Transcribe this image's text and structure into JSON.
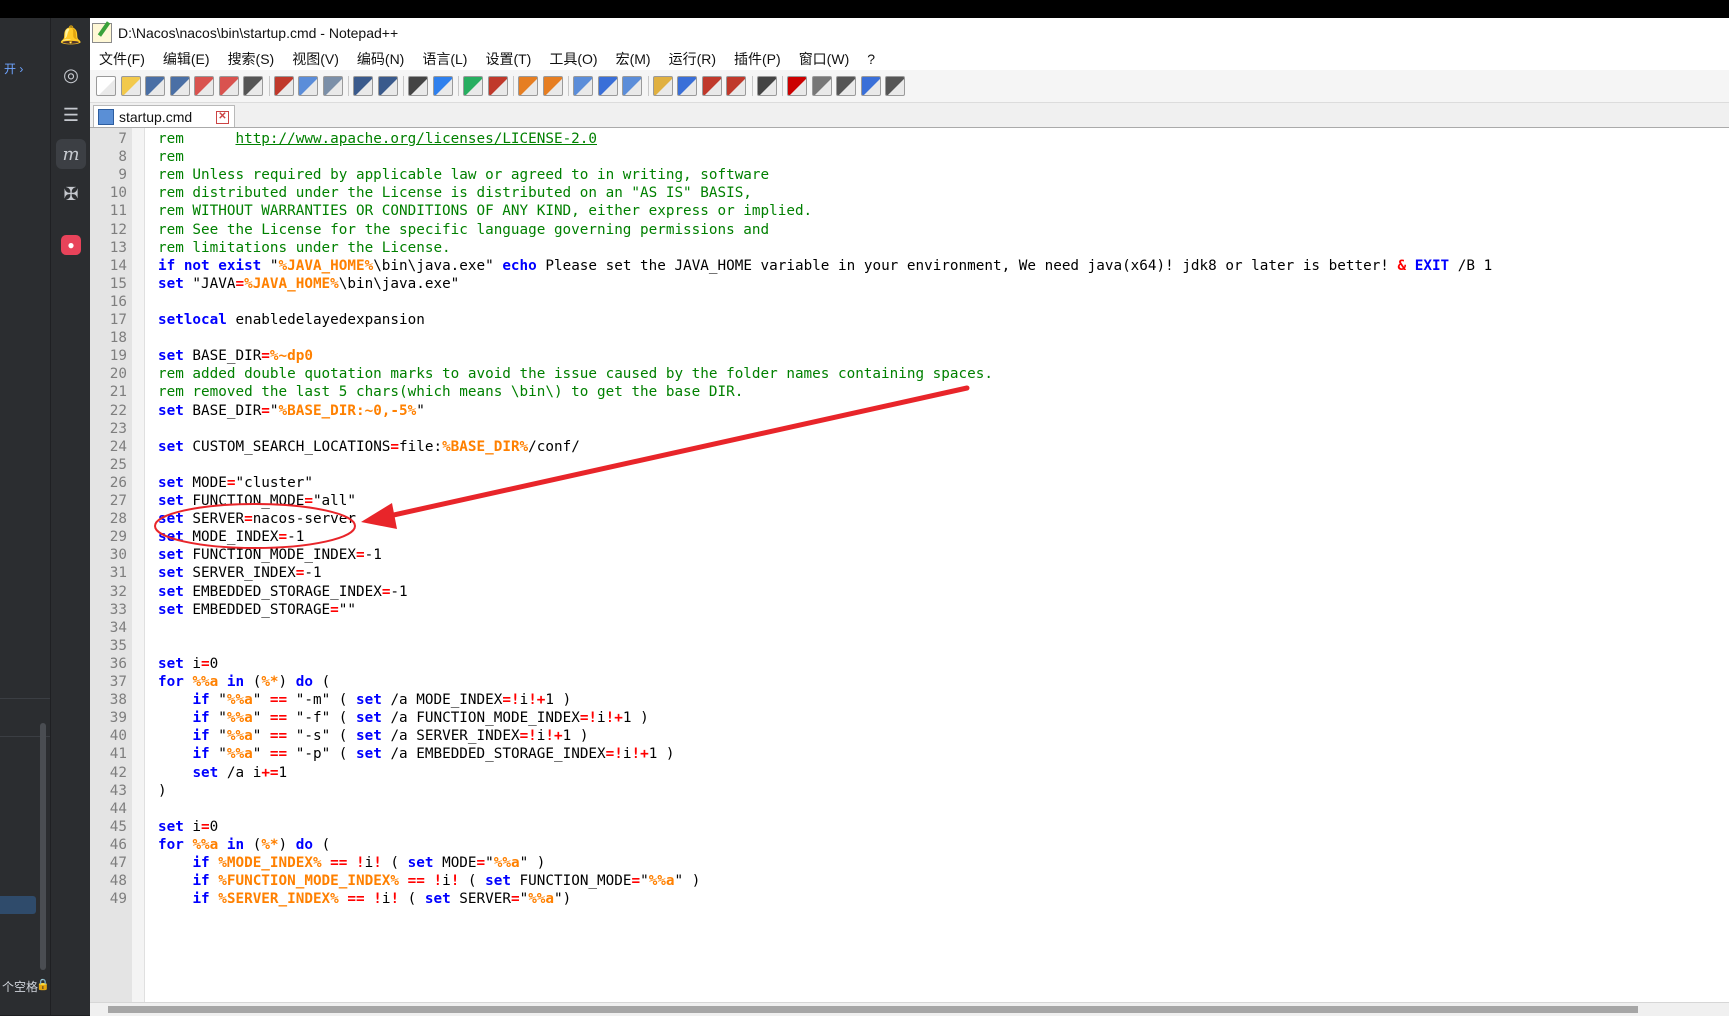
{
  "window": {
    "title": "D:\\Nacos\\nacos\\bin\\startup.cmd - Notepad++"
  },
  "menu": [
    "文件(F)",
    "编辑(E)",
    "搜索(S)",
    "视图(V)",
    "编码(N)",
    "语言(L)",
    "设置(T)",
    "工具(O)",
    "宏(M)",
    "运行(R)",
    "插件(P)",
    "窗口(W)",
    "?"
  ],
  "tab": {
    "label": "startup.cmd",
    "close": "✕"
  },
  "left_sidebar": {
    "nav_text": "开 ›",
    "status_text": "个空格",
    "lock_glyph": "🔒"
  },
  "left_strip_icons": [
    {
      "name": "bell-icon",
      "glyph": "🔔"
    },
    {
      "name": "spiral-icon",
      "glyph": "◎"
    },
    {
      "name": "database-icon",
      "glyph": "☰"
    },
    {
      "name": "m-icon",
      "glyph": "m"
    },
    {
      "name": "tools-icon",
      "glyph": "✠"
    },
    {
      "name": "red-app-icon",
      "glyph": "●"
    }
  ],
  "toolbar_icons": [
    "new-file-icon",
    "open-file-icon",
    "save-icon",
    "save-all-icon",
    "close-icon",
    "close-all-icon",
    "print-icon",
    "cut-icon",
    "copy-icon",
    "paste-icon",
    "undo-icon",
    "redo-icon",
    "find-icon",
    "replace-icon",
    "zoom-in-icon",
    "zoom-out-icon",
    "sync-v-icon",
    "sync-h-icon",
    "word-wrap-icon",
    "show-all-chars-icon",
    "indent-guide-icon",
    "doc-map-icon",
    "function-list-icon",
    "folder-workspace-icon",
    "monitor-icon",
    "eye-icon",
    "record-macro-icon",
    "stop-macro-icon",
    "play-macro-icon",
    "run-macro-multiple-icon",
    "save-macro-icon"
  ],
  "code_lines": [
    {
      "n": "7",
      "t": [
        [
          "rem",
          "rem"
        ],
        [
          "rem",
          "      "
        ],
        [
          "link",
          "http://www.apache.org/licenses/LICENSE-2.0"
        ]
      ]
    },
    {
      "n": "8",
      "t": [
        [
          "rem",
          "rem"
        ]
      ]
    },
    {
      "n": "9",
      "t": [
        [
          "rem",
          "rem Unless required by applicable law or agreed to in writing, software"
        ]
      ]
    },
    {
      "n": "10",
      "t": [
        [
          "rem",
          "rem distributed under the License is distributed on an \"AS IS\" BASIS,"
        ]
      ]
    },
    {
      "n": "11",
      "t": [
        [
          "rem",
          "rem WITHOUT WARRANTIES OR CONDITIONS OF ANY KIND, either express or implied."
        ]
      ]
    },
    {
      "n": "12",
      "t": [
        [
          "rem",
          "rem See the License for the specific language governing permissions and"
        ]
      ]
    },
    {
      "n": "13",
      "t": [
        [
          "rem",
          "rem limitations under the License."
        ]
      ]
    },
    {
      "n": "14",
      "t": [
        [
          "kw",
          "if not exist"
        ],
        [
          "plain",
          " \""
        ],
        [
          "var",
          "%JAVA_HOME%"
        ],
        [
          "plain",
          "\\bin\\java.exe\" "
        ],
        [
          "kw",
          "echo"
        ],
        [
          "plain",
          " Please set the JAVA_HOME variable in your environment, We need java(x64)! jdk8 or later is better! "
        ],
        [
          "op",
          "&"
        ],
        [
          "plain",
          " "
        ],
        [
          "kw",
          "EXIT"
        ],
        [
          "plain",
          " /B 1"
        ]
      ]
    },
    {
      "n": "15",
      "t": [
        [
          "kw",
          "set"
        ],
        [
          "plain",
          " \"JAVA"
        ],
        [
          "op",
          "="
        ],
        [
          "var",
          "%JAVA_HOME%"
        ],
        [
          "plain",
          "\\bin\\java.exe\""
        ]
      ]
    },
    {
      "n": "16",
      "t": []
    },
    {
      "n": "17",
      "t": [
        [
          "kw",
          "setlocal"
        ],
        [
          "plain",
          " enabledelayedexpansion"
        ]
      ]
    },
    {
      "n": "18",
      "t": []
    },
    {
      "n": "19",
      "t": [
        [
          "kw",
          "set"
        ],
        [
          "plain",
          " BASE_DIR"
        ],
        [
          "op",
          "="
        ],
        [
          "var",
          "%~dp0"
        ]
      ]
    },
    {
      "n": "20",
      "t": [
        [
          "rem",
          "rem added double quotation marks to avoid the issue caused by the folder names containing spaces."
        ]
      ]
    },
    {
      "n": "21",
      "t": [
        [
          "rem",
          "rem removed the last 5 chars(which means \\bin\\) to get the base DIR."
        ]
      ]
    },
    {
      "n": "22",
      "t": [
        [
          "kw",
          "set"
        ],
        [
          "plain",
          " BASE_DIR"
        ],
        [
          "op",
          "="
        ],
        [
          "plain",
          "\""
        ],
        [
          "var",
          "%BASE_DIR:~0,-5%"
        ],
        [
          "plain",
          "\""
        ]
      ]
    },
    {
      "n": "23",
      "t": []
    },
    {
      "n": "24",
      "t": [
        [
          "kw",
          "set"
        ],
        [
          "plain",
          " CUSTOM_SEARCH_LOCATIONS"
        ],
        [
          "op",
          "="
        ],
        [
          "plain",
          "file:"
        ],
        [
          "var",
          "%BASE_DIR%"
        ],
        [
          "plain",
          "/conf/"
        ]
      ]
    },
    {
      "n": "25",
      "t": []
    },
    {
      "n": "26",
      "t": [
        [
          "kw",
          "set"
        ],
        [
          "plain",
          " MODE"
        ],
        [
          "op",
          "="
        ],
        [
          "plain",
          "\"cluster\""
        ]
      ]
    },
    {
      "n": "27",
      "t": [
        [
          "kw",
          "set"
        ],
        [
          "plain",
          " FUNCTION_MODE"
        ],
        [
          "op",
          "="
        ],
        [
          "plain",
          "\"all\""
        ]
      ]
    },
    {
      "n": "28",
      "t": [
        [
          "kw",
          "set"
        ],
        [
          "plain",
          " SERVER"
        ],
        [
          "op",
          "="
        ],
        [
          "plain",
          "nacos-server"
        ]
      ]
    },
    {
      "n": "29",
      "t": [
        [
          "kw",
          "set"
        ],
        [
          "plain",
          " MODE_INDEX"
        ],
        [
          "op",
          "="
        ],
        [
          "plain",
          "-1"
        ]
      ]
    },
    {
      "n": "30",
      "t": [
        [
          "kw",
          "set"
        ],
        [
          "plain",
          " FUNCTION_MODE_INDEX"
        ],
        [
          "op",
          "="
        ],
        [
          "plain",
          "-1"
        ]
      ]
    },
    {
      "n": "31",
      "t": [
        [
          "kw",
          "set"
        ],
        [
          "plain",
          " SERVER_INDEX"
        ],
        [
          "op",
          "="
        ],
        [
          "plain",
          "-1"
        ]
      ]
    },
    {
      "n": "32",
      "t": [
        [
          "kw",
          "set"
        ],
        [
          "plain",
          " EMBEDDED_STORAGE_INDEX"
        ],
        [
          "op",
          "="
        ],
        [
          "plain",
          "-1"
        ]
      ]
    },
    {
      "n": "33",
      "t": [
        [
          "kw",
          "set"
        ],
        [
          "plain",
          " EMBEDDED_STORAGE"
        ],
        [
          "op",
          "="
        ],
        [
          "plain",
          "\"\""
        ]
      ]
    },
    {
      "n": "34",
      "t": []
    },
    {
      "n": "35",
      "t": []
    },
    {
      "n": "36",
      "t": [
        [
          "kw",
          "set"
        ],
        [
          "plain",
          " i"
        ],
        [
          "op",
          "="
        ],
        [
          "plain",
          "0"
        ]
      ]
    },
    {
      "n": "37",
      "t": [
        [
          "kw",
          "for"
        ],
        [
          "plain",
          " "
        ],
        [
          "var",
          "%%a"
        ],
        [
          "plain",
          " "
        ],
        [
          "kw",
          "in"
        ],
        [
          "plain",
          " ("
        ],
        [
          "var",
          "%*"
        ],
        [
          "plain",
          ") "
        ],
        [
          "kw",
          "do"
        ],
        [
          "plain",
          " ("
        ]
      ]
    },
    {
      "n": "38",
      "t": [
        [
          "plain",
          "    "
        ],
        [
          "kw",
          "if"
        ],
        [
          "plain",
          " \""
        ],
        [
          "var",
          "%%a"
        ],
        [
          "plain",
          "\" "
        ],
        [
          "op",
          "=="
        ],
        [
          "plain",
          " \"-m\" ( "
        ],
        [
          "kw",
          "set"
        ],
        [
          "plain",
          " /a MODE_INDEX"
        ],
        [
          "op",
          "=!"
        ],
        [
          "plain",
          "i"
        ],
        [
          "op",
          "!+"
        ],
        [
          "plain",
          "1 )"
        ]
      ]
    },
    {
      "n": "39",
      "t": [
        [
          "plain",
          "    "
        ],
        [
          "kw",
          "if"
        ],
        [
          "plain",
          " \""
        ],
        [
          "var",
          "%%a"
        ],
        [
          "plain",
          "\" "
        ],
        [
          "op",
          "=="
        ],
        [
          "plain",
          " \"-f\" ( "
        ],
        [
          "kw",
          "set"
        ],
        [
          "plain",
          " /a FUNCTION_MODE_INDEX"
        ],
        [
          "op",
          "=!"
        ],
        [
          "plain",
          "i"
        ],
        [
          "op",
          "!+"
        ],
        [
          "plain",
          "1 )"
        ]
      ]
    },
    {
      "n": "40",
      "t": [
        [
          "plain",
          "    "
        ],
        [
          "kw",
          "if"
        ],
        [
          "plain",
          " \""
        ],
        [
          "var",
          "%%a"
        ],
        [
          "plain",
          "\" "
        ],
        [
          "op",
          "=="
        ],
        [
          "plain",
          " \"-s\" ( "
        ],
        [
          "kw",
          "set"
        ],
        [
          "plain",
          " /a SERVER_INDEX"
        ],
        [
          "op",
          "=!"
        ],
        [
          "plain",
          "i"
        ],
        [
          "op",
          "!+"
        ],
        [
          "plain",
          "1 )"
        ]
      ]
    },
    {
      "n": "41",
      "t": [
        [
          "plain",
          "    "
        ],
        [
          "kw",
          "if"
        ],
        [
          "plain",
          " \""
        ],
        [
          "var",
          "%%a"
        ],
        [
          "plain",
          "\" "
        ],
        [
          "op",
          "=="
        ],
        [
          "plain",
          " \"-p\" ( "
        ],
        [
          "kw",
          "set"
        ],
        [
          "plain",
          " /a EMBEDDED_STORAGE_INDEX"
        ],
        [
          "op",
          "=!"
        ],
        [
          "plain",
          "i"
        ],
        [
          "op",
          "!+"
        ],
        [
          "plain",
          "1 )"
        ]
      ]
    },
    {
      "n": "42",
      "t": [
        [
          "plain",
          "    "
        ],
        [
          "kw",
          "set"
        ],
        [
          "plain",
          " /a i"
        ],
        [
          "op",
          "+="
        ],
        [
          "plain",
          "1"
        ]
      ]
    },
    {
      "n": "43",
      "t": [
        [
          "plain",
          ")"
        ]
      ]
    },
    {
      "n": "44",
      "t": []
    },
    {
      "n": "45",
      "t": [
        [
          "kw",
          "set"
        ],
        [
          "plain",
          " i"
        ],
        [
          "op",
          "="
        ],
        [
          "plain",
          "0"
        ]
      ]
    },
    {
      "n": "46",
      "t": [
        [
          "kw",
          "for"
        ],
        [
          "plain",
          " "
        ],
        [
          "var",
          "%%a"
        ],
        [
          "plain",
          " "
        ],
        [
          "kw",
          "in"
        ],
        [
          "plain",
          " ("
        ],
        [
          "var",
          "%*"
        ],
        [
          "plain",
          ") "
        ],
        [
          "kw",
          "do"
        ],
        [
          "plain",
          " ("
        ]
      ]
    },
    {
      "n": "47",
      "t": [
        [
          "plain",
          "    "
        ],
        [
          "kw",
          "if"
        ],
        [
          "plain",
          " "
        ],
        [
          "var",
          "%MODE_INDEX%"
        ],
        [
          "plain",
          " "
        ],
        [
          "op",
          "=="
        ],
        [
          "plain",
          " "
        ],
        [
          "op",
          "!"
        ],
        [
          "plain",
          "i"
        ],
        [
          "op",
          "!"
        ],
        [
          "plain",
          " ( "
        ],
        [
          "kw",
          "set"
        ],
        [
          "plain",
          " MODE"
        ],
        [
          "op",
          "="
        ],
        [
          "plain",
          "\""
        ],
        [
          "var",
          "%%a"
        ],
        [
          "plain",
          "\" )"
        ]
      ]
    },
    {
      "n": "48",
      "t": [
        [
          "plain",
          "    "
        ],
        [
          "kw",
          "if"
        ],
        [
          "plain",
          " "
        ],
        [
          "var",
          "%FUNCTION_MODE_INDEX%"
        ],
        [
          "plain",
          " "
        ],
        [
          "op",
          "=="
        ],
        [
          "plain",
          " "
        ],
        [
          "op",
          "!"
        ],
        [
          "plain",
          "i"
        ],
        [
          "op",
          "!"
        ],
        [
          "plain",
          " ( "
        ],
        [
          "kw",
          "set"
        ],
        [
          "plain",
          " FUNCTION_MODE"
        ],
        [
          "op",
          "="
        ],
        [
          "plain",
          "\""
        ],
        [
          "var",
          "%%a"
        ],
        [
          "plain",
          "\" )"
        ]
      ]
    },
    {
      "n": "49",
      "t": [
        [
          "plain",
          "    "
        ],
        [
          "kw",
          "if"
        ],
        [
          "plain",
          " "
        ],
        [
          "var",
          "%SERVER_INDEX%"
        ],
        [
          "plain",
          " "
        ],
        [
          "op",
          "=="
        ],
        [
          "plain",
          " "
        ],
        [
          "op",
          "!"
        ],
        [
          "plain",
          "i"
        ],
        [
          "op",
          "!"
        ],
        [
          "plain",
          " ( "
        ],
        [
          "kw",
          "set"
        ],
        [
          "plain",
          " SERVER"
        ],
        [
          "op",
          "="
        ],
        [
          "plain",
          "\""
        ],
        [
          "var",
          "%%a"
        ],
        [
          "plain",
          "\")"
        ]
      ]
    }
  ],
  "colors": {
    "comment": "#008000",
    "keyword": "#0000ff",
    "variable": "#ff8000",
    "operator": "#ff0000",
    "annotation": "#e8252a"
  }
}
